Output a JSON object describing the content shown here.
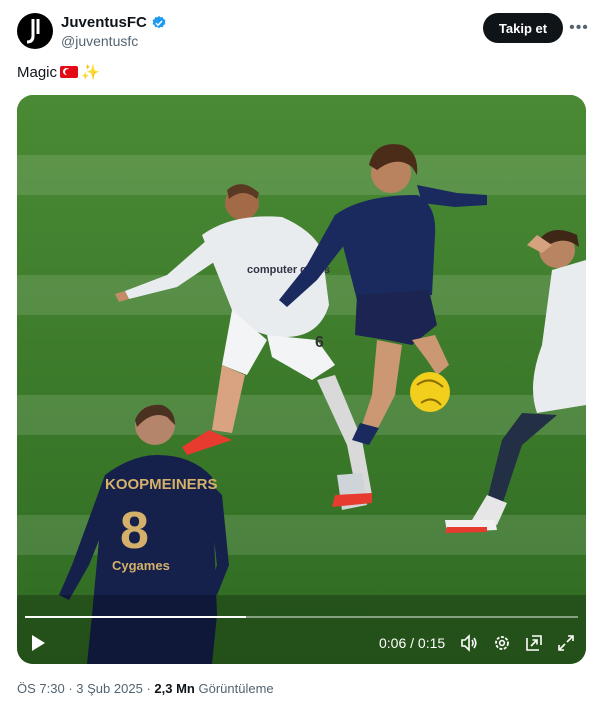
{
  "author": {
    "name": "JuventusFC",
    "handle": "@juventusfc",
    "verified": true,
    "follow_label": "Takip et"
  },
  "tweet": {
    "text": "Magic",
    "emojis": [
      "turkey-flag",
      "sparkles"
    ]
  },
  "video": {
    "current_time": "0:06",
    "separator": "/",
    "duration": "0:15",
    "progress_fraction": 0.4,
    "players": {
      "back_name": "KOOPMEINERS",
      "back_number": "8",
      "sponsor": "Cygames",
      "opponent_number": "6",
      "opponent_sponsor": "computer gross"
    }
  },
  "meta": {
    "time": "ÖS 7:30",
    "dot1": "·",
    "date": "3 Şub 2025",
    "dot2": "·",
    "views_count": "2,3 Mn",
    "views_label": "Görüntüleme"
  },
  "colors": {
    "verified": "#1d9bf0",
    "follow_bg": "#0f1419",
    "secondary_text": "#536471",
    "pitch": "#3d7a2c"
  }
}
